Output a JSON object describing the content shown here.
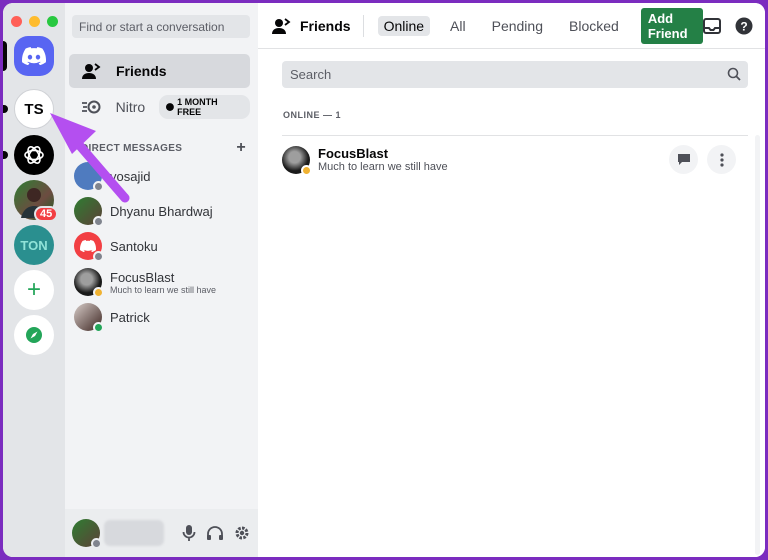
{
  "dm_sidebar": {
    "search_placeholder": "Find or start a conversation",
    "friends_label": "Friends",
    "nitro_label": "Nitro",
    "nitro_badge": "1 MONTH FREE",
    "direct_messages_header": "DIRECT MESSAGES",
    "direct_messages_add": "+",
    "items": [
      {
        "name": "yosajid",
        "status": "offline",
        "subtitle": ""
      },
      {
        "name": "Dhyanu Bhardwaj",
        "status": "offline",
        "subtitle": ""
      },
      {
        "name": "Santoku",
        "status": "offline",
        "subtitle": ""
      },
      {
        "name": "FocusBlast",
        "status": "idle",
        "subtitle": "Much to learn we still have"
      },
      {
        "name": "Patrick",
        "status": "online",
        "subtitle": ""
      }
    ]
  },
  "rail": {
    "servers": [
      {
        "name": "discord-home",
        "label": ""
      },
      {
        "name": "TS",
        "label": "TS"
      },
      {
        "name": "chatgpt",
        "label": ""
      },
      {
        "name": "user-server",
        "label": "",
        "badge": "45"
      },
      {
        "name": "TON",
        "label": "TON"
      },
      {
        "name": "add-server",
        "label": "+"
      },
      {
        "name": "explore",
        "label": ""
      }
    ]
  },
  "topbar": {
    "title": "Friends",
    "tabs": [
      "Online",
      "All",
      "Pending",
      "Blocked"
    ],
    "active_tab": "Online",
    "add_friend": "Add Friend"
  },
  "main": {
    "search_placeholder": "Search",
    "online_header": "ONLINE — 1",
    "friends": [
      {
        "name": "FocusBlast",
        "subtitle": "Much to learn we still have",
        "status": "idle"
      }
    ]
  },
  "colors": {
    "accent": "#5865f2",
    "add_friend": "#248046",
    "online": "#23a559",
    "idle": "#f0b232",
    "offline": "#80848e",
    "annotation_arrow": "#b44ff0"
  }
}
